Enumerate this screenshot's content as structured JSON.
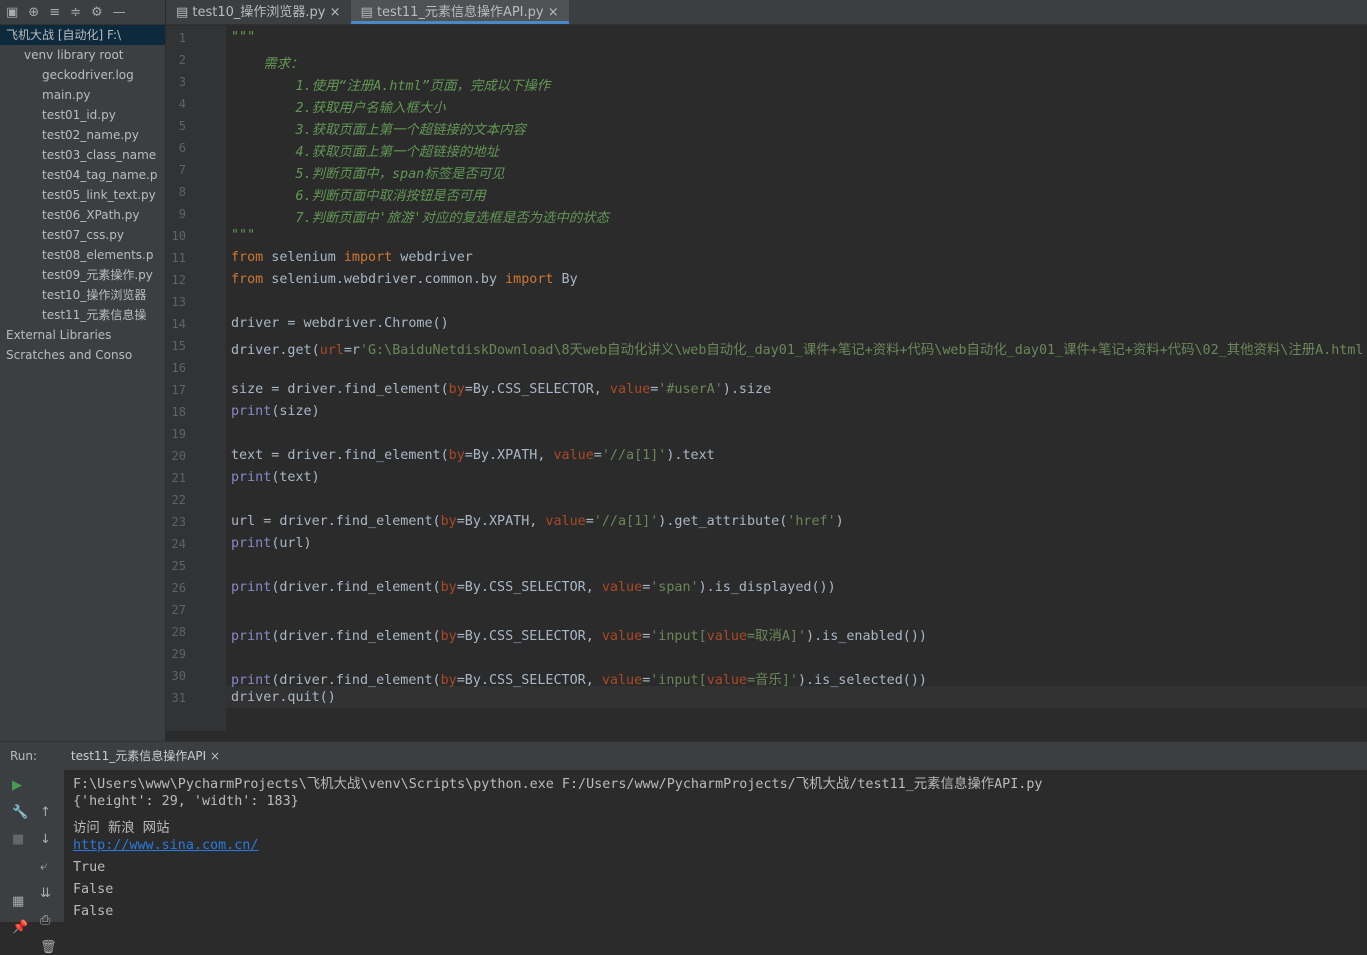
{
  "tabs": [
    {
      "label": "test10_操作浏览器.py",
      "active": false
    },
    {
      "label": "test11_元素信息操作API.py",
      "active": true
    }
  ],
  "tree": [
    {
      "text": "飞机大战 [自动化]  F:\\",
      "indent": 0,
      "sel": true
    },
    {
      "text": "venv  library root",
      "indent": 1
    },
    {
      "text": "geckodriver.log",
      "indent": 2
    },
    {
      "text": "main.py",
      "indent": 2
    },
    {
      "text": "test01_id.py",
      "indent": 2
    },
    {
      "text": "test02_name.py",
      "indent": 2
    },
    {
      "text": "test03_class_name",
      "indent": 2
    },
    {
      "text": "test04_tag_name.p",
      "indent": 2
    },
    {
      "text": "test05_link_text.py",
      "indent": 2
    },
    {
      "text": "test06_XPath.py",
      "indent": 2
    },
    {
      "text": "test07_css.py",
      "indent": 2
    },
    {
      "text": "test08_elements.p",
      "indent": 2
    },
    {
      "text": "test09_元素操作.py",
      "indent": 2
    },
    {
      "text": "test10_操作浏览器",
      "indent": 2
    },
    {
      "text": "test11_元素信息操",
      "indent": 2
    },
    {
      "text": "External Libraries",
      "indent": 0
    },
    {
      "text": "Scratches and Conso",
      "indent": 0
    }
  ],
  "code": [
    "\"\"\"",
    "    需求：",
    "        1.使用“注册A.html”页面，完成以下操作",
    "        2.获取用户名输入框大小",
    "        3.获取页面上第一个超链接的文本内容",
    "        4.获取页面上第一个超链接的地址",
    "        5.判断页面中，span标签是否可见",
    "        6.判断页面中取消按钮是否可用",
    "        7.判断页面中'旅游'对应的复选框是否为选中的状态",
    "\"\"\"",
    "from selenium import webdriver",
    "from selenium.webdriver.common.by import By",
    "",
    "driver = webdriver.Chrome()",
    "driver.get(url=r'G:\\BaiduNetdiskDownload\\8天web自动化讲义\\web自动化_day01_课件+笔记+资料+代码\\web自动化_day01_课件+笔记+资料+代码\\02_其他资料\\注册A.html')",
    "",
    "size = driver.find_element(by=By.CSS_SELECTOR, value='#userA').size",
    "print(size)",
    "",
    "text = driver.find_element(by=By.XPATH, value='//a[1]').text",
    "print(text)",
    "",
    "url = driver.find_element(by=By.XPATH, value='//a[1]').get_attribute('href')",
    "print(url)",
    "",
    "print(driver.find_element(by=By.CSS_SELECTOR, value='span').is_displayed())",
    "",
    "print(driver.find_element(by=By.CSS_SELECTOR, value='input[value=取消A]').is_enabled())",
    "",
    "print(driver.find_element(by=By.CSS_SELECTOR, value='input[value=音乐]').is_selected())",
    "driver.quit()"
  ],
  "run": {
    "label": "Run:",
    "tab": "test11_元素信息操作API",
    "output": [
      "F:\\Users\\www\\PycharmProjects\\飞机大战\\venv\\Scripts\\python.exe F:/Users/www/PycharmProjects/飞机大战/test11_元素信息操作API.py",
      "{'height': 29, 'width': 183}",
      "访问 新浪 网站",
      "http://www.sina.com.cn/",
      "True",
      "False",
      "False"
    ]
  }
}
